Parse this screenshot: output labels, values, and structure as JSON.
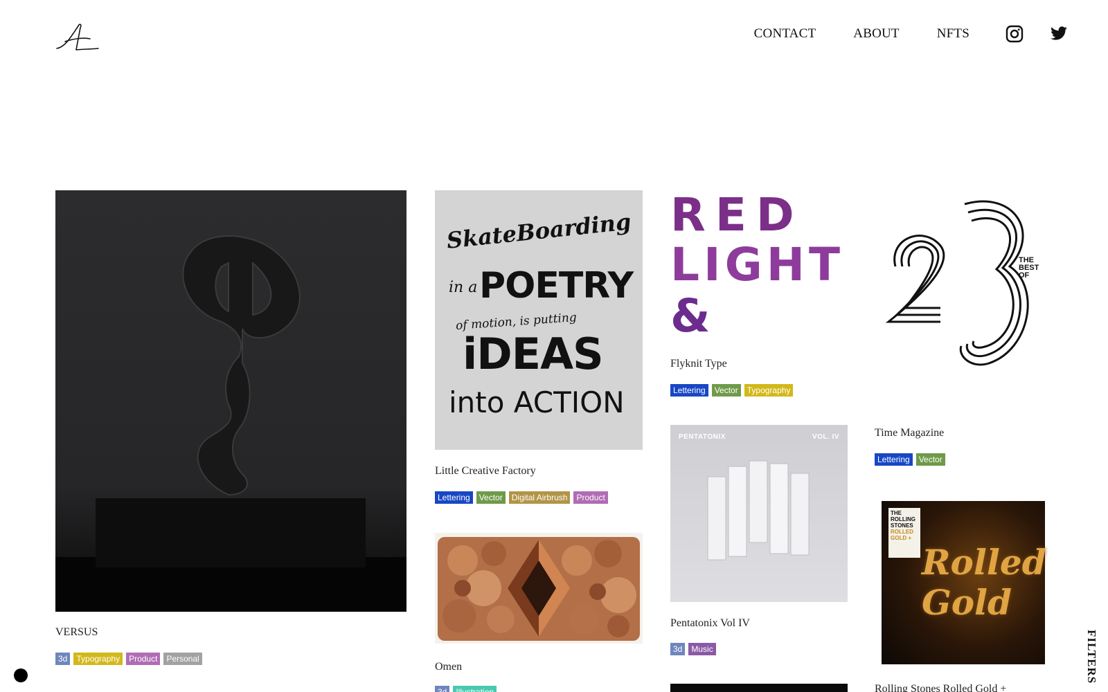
{
  "nav": {
    "contact": "CONTACT",
    "about": "ABOUT",
    "nfts": "NFTS",
    "instagram_icon": "instagram-icon",
    "twitter_icon": "twitter-icon"
  },
  "projects": [
    {
      "title": "VERSUS",
      "tags": [
        "3d",
        "Typography",
        "Product",
        "Personal"
      ]
    },
    {
      "title": "Little Creative Factory",
      "tags": [
        "Lettering",
        "Vector",
        "Digital Airbrush",
        "Product"
      ]
    },
    {
      "title": "Omen",
      "tags": [
        "3d",
        "Illustration"
      ]
    },
    {
      "title": "Flyknit Type",
      "tags": [
        "Lettering",
        "Vector",
        "Typography"
      ]
    },
    {
      "title": "Pentatonix Vol IV",
      "tags": [
        "3d",
        "Music"
      ]
    },
    {
      "title": "Time Magazine",
      "tags": [
        "Lettering",
        "Vector"
      ]
    },
    {
      "title": "Rolling Stones Rolled Gold +",
      "tags": []
    }
  ],
  "artwork_text": {
    "skate": [
      "SkateBoarding",
      "in a",
      "POETRY",
      "of motion, is putting",
      "iDEAS",
      "into ACTION"
    ],
    "flyknit": [
      "RED",
      "LIGHT",
      "& BLUE"
    ],
    "pentatonix_left": "PENTATONIX",
    "pentatonix_right": "VOL. IV",
    "time_best": [
      "THE",
      "BEST",
      "OF"
    ],
    "time_number": "23",
    "stones_label": [
      "THE",
      "ROLLING",
      "STONES",
      "ROLLED",
      "GOLD +"
    ],
    "stones_script": "Rolled Gold"
  },
  "tag_colors": {
    "3d": "#6f86bd",
    "Typography": "#d2b819",
    "Product": "#b06cb4",
    "Personal": "#a2a2a2",
    "Lettering": "#1747c4",
    "Vector": "#6f9a4a",
    "Digital Airbrush": "#b29447",
    "Music": "#8a5aa6",
    "Illustration": "#49c9b0"
  },
  "filters_label": "FILTERS"
}
